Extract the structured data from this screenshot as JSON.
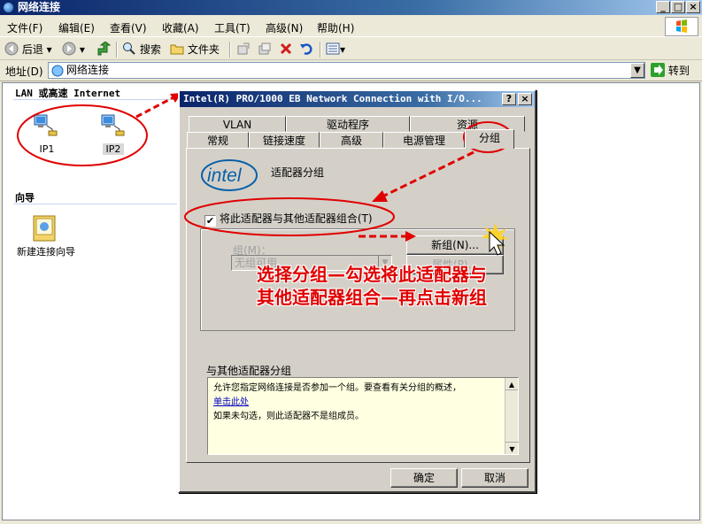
{
  "window": {
    "title": "网络连接"
  },
  "menubar": {
    "items": [
      "文件(F)",
      "编辑(E)",
      "查看(V)",
      "收藏(A)",
      "工具(T)",
      "高级(N)",
      "帮助(H)"
    ]
  },
  "toolbar": {
    "back": "后退",
    "search": "搜索",
    "folders": "文件夹"
  },
  "addressbar": {
    "label": "地址(D)",
    "value": "网络连接",
    "go": "转到"
  },
  "leftpane": {
    "section1_title": "LAN 或高速 Internet",
    "connections": [
      {
        "label": "IP1"
      },
      {
        "label": "IP2"
      }
    ],
    "section2_title": "向导",
    "wizard_label": "新建连接向导"
  },
  "dialog": {
    "title": "Intel(R) PRO/1000 EB Network Connection with I/O...",
    "help_btn": "?",
    "close_btn": "×",
    "tabs_row1": [
      "VLAN",
      "驱动程序",
      "资源"
    ],
    "tabs_row2": [
      "常规",
      "链接速度",
      "高级",
      "电源管理",
      "分组"
    ],
    "active_tab": "分组",
    "brand": "intel",
    "heading": "适配器分组",
    "team_checkbox_label": "将此适配器与其他适配器组合(T)",
    "team_checked": true,
    "new_group_btn": "新组(N)...",
    "group_label": "组(M)：",
    "group_select_value": "无组可用",
    "properties_btn": "属性(P)...",
    "desc_title": "与其他适配器分组",
    "desc_line1": "允许您指定网络连接是否参加一个组。要查看有关分组的概述，",
    "desc_link": "单击此处",
    "desc_line2": "如果未勾选，则此适配器不是组成员。",
    "ok_btn": "确定",
    "cancel_btn": "取消"
  },
  "annotation": {
    "line1": "选择分组—勾选将此适配器与",
    "line2": "其他适配器组合—再点击新组"
  },
  "colors": {
    "annotation_red": "#e00000",
    "titlebar_blue": "#0a246a"
  }
}
